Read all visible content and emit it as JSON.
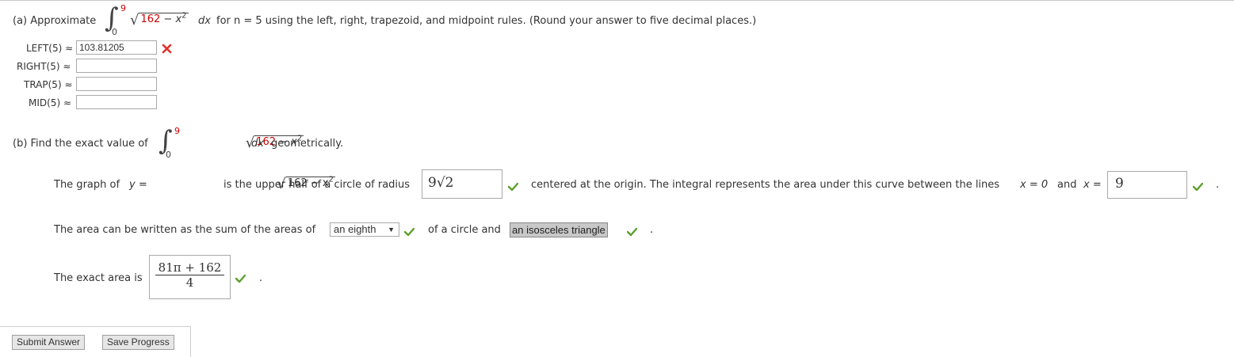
{
  "part_a": {
    "prefix": "(a) Approximate",
    "integral": {
      "lower": "0",
      "upper": "9",
      "radicand_const": "162",
      "radicand_rest": " − x",
      "exp": "2",
      "dx": "dx"
    },
    "instruction": "for n = 5 using the left, right, trapezoid, and midpoint rules. (Round your answer to five decimal places.)",
    "rows": [
      {
        "label": "LEFT(5) ≈",
        "value": "103.81205",
        "status": "incorrect"
      },
      {
        "label": "RIGHT(5) ≈",
        "value": "",
        "status": ""
      },
      {
        "label": "TRAP(5) ≈",
        "value": "",
        "status": ""
      },
      {
        "label": "MID(5) ≈",
        "value": "",
        "status": ""
      }
    ]
  },
  "part_b": {
    "prefix": "(b) Find the exact value of",
    "integral": {
      "lower": "0",
      "upper": "9",
      "radicand_const": "162",
      "radicand_rest": " − x",
      "exp": "2",
      "dx": "dx"
    },
    "suffix": "geometrically.",
    "graph_sentence": {
      "lead": "The graph of",
      "y_eq": "y =",
      "radicand": "162 − x",
      "exp": "2",
      "middle": "is the upper half of a circle of radius",
      "radius_answer": "9√2",
      "after_radius": "centered at the origin. The integral represents the area under this curve between the lines",
      "x0": "x = 0",
      "and": "and",
      "x_eq": "x =",
      "x_answer": "9",
      "end": "."
    },
    "area_sentence": {
      "lead": "The area can be written as the sum of the areas of",
      "select_value": "an eighth",
      "middle": "of a circle and",
      "shape_answer": "an isosceles triangle",
      "end": "."
    },
    "exact_area": {
      "lead": "The exact area is",
      "numerator": "81π + 162",
      "denominator": "4",
      "end": "."
    }
  },
  "buttons": {
    "submit": "Submit Answer",
    "save": "Save Progress"
  },
  "colors": {
    "correct": "#5aa02c",
    "incorrect": "#e0302a",
    "upper_limit": "#cc0000"
  }
}
